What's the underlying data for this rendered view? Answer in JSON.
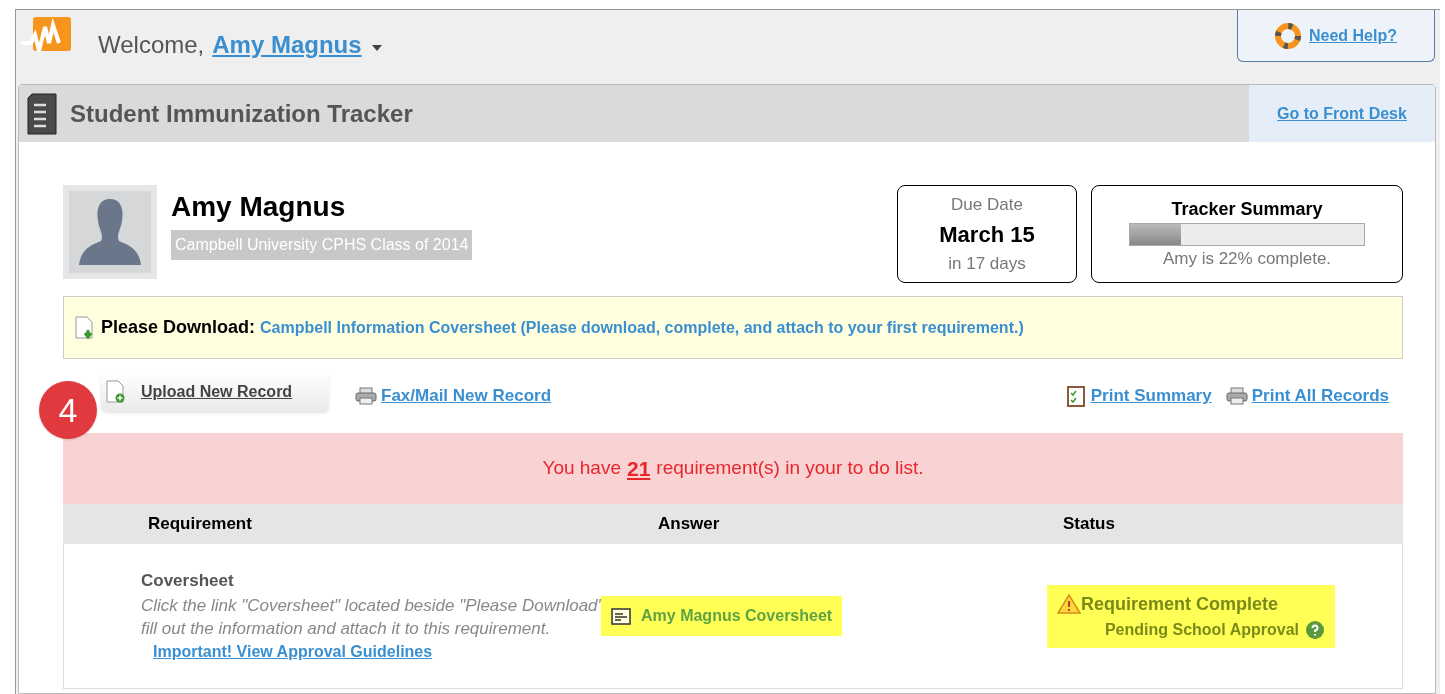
{
  "header": {
    "welcome": "Welcome,",
    "user": "Amy Magnus",
    "help": "Need Help?"
  },
  "panel": {
    "title": "Student Immunization Tracker",
    "front_desk": "Go to Front Desk"
  },
  "student": {
    "name": "Amy Magnus",
    "class": "Campbell University CPHS Class of 2014"
  },
  "due": {
    "label": "Due Date",
    "date": "March 15",
    "remaining": "in 17 days"
  },
  "summary": {
    "title": "Tracker Summary",
    "level": 0.22,
    "text": "Amy is 22% complete."
  },
  "download": {
    "label": "Please Download:",
    "link": "Campbell Information Coversheet (Please download, complete, and attach to your first requirement.)"
  },
  "actions": {
    "upload": "Upload New Record",
    "fax": "Fax/Mail New Record",
    "print_summary": "Print Summary",
    "print_all": "Print All Records",
    "step": "4"
  },
  "todo": {
    "prefix": "You have",
    "count": "21",
    "suffix": "requirement(s) in your to do list."
  },
  "table": {
    "columns": [
      "Requirement",
      "Answer",
      "Status"
    ],
    "rows": [
      {
        "title": "Coversheet",
        "description": "Click the link \"Coversheet\" located beside \"Please Download\" fill out the information and attach it to this requirement.",
        "guidelines": "Important! View Approval Guidelines",
        "answer": "Amy Magnus Coversheet",
        "status": "Requirement Complete",
        "substatus": "Pending School Approval"
      }
    ]
  }
}
